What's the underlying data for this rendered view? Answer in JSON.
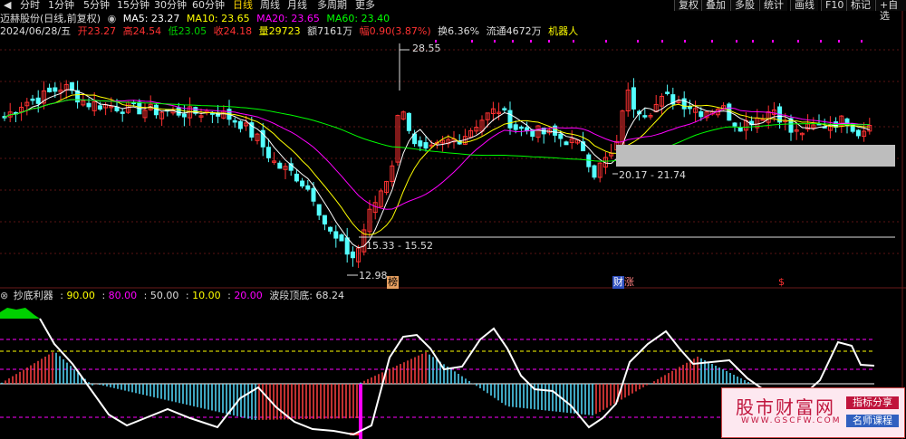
{
  "periods": [
    {
      "label": "分时",
      "active": false
    },
    {
      "label": "1分钟",
      "active": false
    },
    {
      "label": "5分钟",
      "active": false
    },
    {
      "label": "15分钟",
      "active": false
    },
    {
      "label": "30分钟",
      "active": false
    },
    {
      "label": "60分钟",
      "active": false
    },
    {
      "label": "日线",
      "active": true
    },
    {
      "label": "周线",
      "active": false
    },
    {
      "label": "月线",
      "active": false
    },
    {
      "label": "多周期",
      "active": false
    },
    {
      "label": "更多",
      "active": false
    }
  ],
  "toolbar": [
    "复权",
    "叠加",
    "多股",
    "统计",
    "画线",
    "F10",
    "标记",
    "+自选"
  ],
  "header": {
    "title": "迈赫股份(日线,前复权)",
    "ma5": "MA5: 23.27",
    "ma10": "MA10: 23.65",
    "ma20": "MA20: 23.65",
    "ma60": "MA60: 23.40"
  },
  "info": {
    "date": "2024/06/28/五",
    "open": "开23.27",
    "high": "高24.54",
    "low": "低23.05",
    "close": "收24.18",
    "vol": "量29723",
    "amount": "额7161万",
    "range": "幅0.90(3.87%)",
    "turnover": "换6.36%",
    "float": "流通4672万",
    "robot": "机器人"
  },
  "annotations": {
    "peak": "28.55",
    "low": "12.98",
    "box1": "15.33 - 15.52",
    "box2": "20.17 - 21.74",
    "tag_bang": "榜",
    "tag_caibao": "财",
    "tag_zhang": "涨",
    "tag_dollar": "$"
  },
  "indicator": {
    "name": "抄底利器",
    "v1": "90.00",
    "v2": "80.00",
    "v3": "50.00",
    "v4": "10.00",
    "v5": "20.00",
    "wave": "波段顶底: 68.24"
  },
  "watermark": {
    "title": "股市财富网",
    "url": "WWW.GSCFW.COM",
    "tag1": "指标分享",
    "tag2": "名师课程"
  },
  "colors": {
    "up": "#ff3232",
    "down": "#54ffff",
    "ma5": "#ffffff",
    "ma10": "#ffff00",
    "ma20": "#ff00ff",
    "ma60": "#00ff00"
  }
}
